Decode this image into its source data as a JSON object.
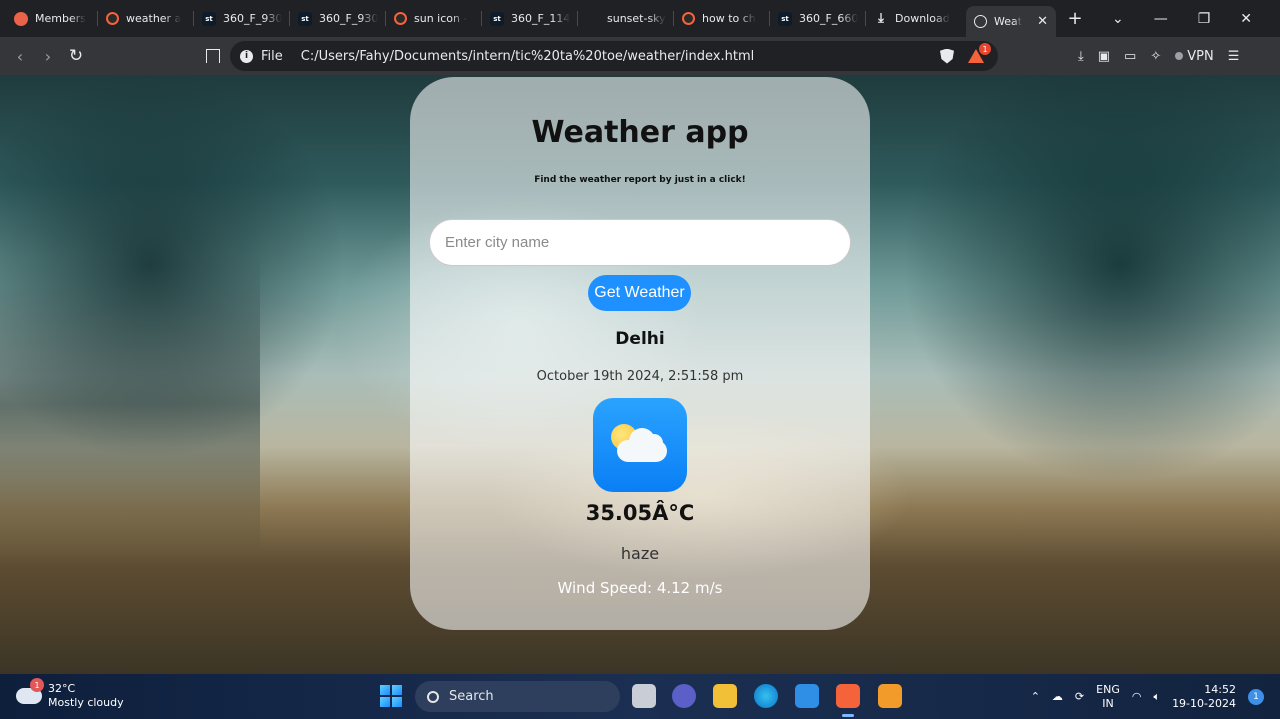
{
  "browser": {
    "tabs": [
      {
        "label": "Members",
        "icon": "members-icon"
      },
      {
        "label": "weather a",
        "icon": "brave-icon"
      },
      {
        "label": "360_F_930",
        "icon": "st-icon"
      },
      {
        "label": "360_F_930",
        "icon": "st-icon"
      },
      {
        "label": "sun icon -",
        "icon": "brave-icon"
      },
      {
        "label": "360_F_114",
        "icon": "st-icon"
      },
      {
        "label": "sunset-sky",
        "icon": "blank-icon"
      },
      {
        "label": "how to ch",
        "icon": "brave-icon"
      },
      {
        "label": "360_F_660",
        "icon": "st-icon"
      },
      {
        "label": "Download",
        "icon": "download-icon"
      }
    ],
    "active_tab": {
      "label": "Weat",
      "icon": "globe-icon"
    },
    "new_tab": "+",
    "scheme_label": "File",
    "url": "C:/Users/Fahy/Documents/intern/tic%20ta%20toe/weather/index.html",
    "rewards_count": "1",
    "vpn_label": "VPN"
  },
  "app": {
    "title": "Weather app",
    "subtitle": "Find the weather report by just in a click!",
    "input_placeholder": "Enter city name",
    "button_label": "Get Weather",
    "city": "Delhi",
    "datetime": "October 19th 2024, 2:51:58 pm",
    "temperature": "35.05Â°C",
    "description": "haze",
    "wind": "Wind Speed: 4.12 m/s",
    "icon": "partly-cloudy-icon"
  },
  "taskbar": {
    "weather_temp": "32°C",
    "weather_desc": "Mostly cloudy",
    "weather_badge": "1",
    "search_label": "Search",
    "lang_top": "ENG",
    "lang_bottom": "IN",
    "time": "14:52",
    "date": "19-10-2024",
    "notification_count": "1"
  }
}
